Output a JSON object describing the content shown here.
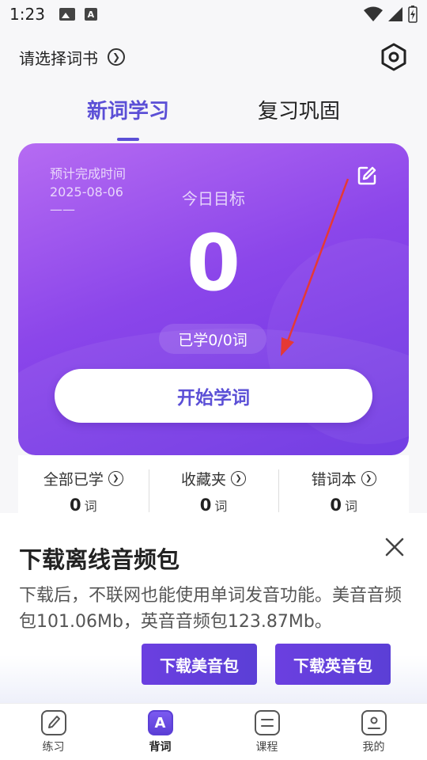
{
  "status_bar": {
    "time": "1:23"
  },
  "topbar": {
    "book_select": "请选择词书"
  },
  "tabs": [
    {
      "label": "新词学习",
      "active": true
    },
    {
      "label": "复习巩固",
      "active": false
    }
  ],
  "card": {
    "finish_label": "预计完成时间",
    "finish_date": "2025-08-06",
    "finish_extra": "——",
    "goal_label": "今日目标",
    "goal_value": "0",
    "learned": "已学0/0词",
    "start_button": "开始学词"
  },
  "stats": [
    {
      "label": "全部已学",
      "value": "0",
      "unit": "词"
    },
    {
      "label": "收藏夹",
      "value": "0",
      "unit": "词"
    },
    {
      "label": "错词本",
      "value": "0",
      "unit": "词"
    }
  ],
  "dialog": {
    "title": "下载离线音频包",
    "desc": "下载后，不联网也能使用单词发音功能。美音音频包101.06Mb，英音音频包123.87Mb。",
    "btn_us": "下载美音包",
    "btn_uk": "下载英音包"
  },
  "nav": [
    {
      "label": "练习",
      "icon": "pen-icon",
      "active": false
    },
    {
      "label": "背词",
      "icon": "letter-a-icon",
      "active": true,
      "glyph": "A"
    },
    {
      "label": "课程",
      "icon": "book-icon",
      "active": false
    },
    {
      "label": "我的",
      "icon": "profile-icon",
      "active": false
    }
  ],
  "colors": {
    "accent": "#5b4fd6",
    "arrow": "#e53935"
  }
}
